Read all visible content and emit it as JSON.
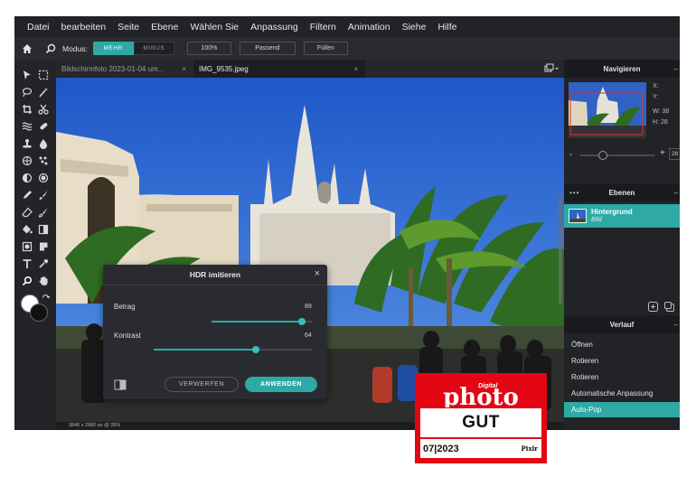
{
  "menu": [
    "Datei",
    "bearbeiten",
    "Seite",
    "Ebene",
    "Wählen Sie",
    "Anpassung",
    "Filtern",
    "Animation",
    "Siehe",
    "Hilfe"
  ],
  "toolbar": {
    "mode_label": "Modus:",
    "mode_active": "MEHR",
    "mode_inactive": "MINUS",
    "zoom": "100%",
    "fit": "Passend",
    "fill": "Füllen"
  },
  "tabs": [
    {
      "label": "Bildschirmfoto 2023-01-04 um...",
      "close": "×"
    },
    {
      "label": "IMG_9535.jpeg",
      "close": "×"
    }
  ],
  "status": "3840 x 2880 px @ 28%",
  "dialog": {
    "title": "HDR imitieren",
    "close": "×",
    "amount_label": "Betrag",
    "amount_value": 89,
    "contrast_label": "Kontrast",
    "contrast_value": 64,
    "discard": "VERWERFEN",
    "apply": "ANWENDEN"
  },
  "navigator": {
    "title": "Navigieren",
    "x_label": "X:",
    "y_label": "Y:",
    "w_label": "W:",
    "w_value": "38",
    "h_label": "H:",
    "h_value": "28",
    "zoom_value": "28",
    "zoom_position": 0.3
  },
  "layers": {
    "title": "Ebenen",
    "name": "Hintergrund",
    "type": "Bild"
  },
  "history": {
    "title": "Verlauf",
    "items": [
      "Öffnen",
      "Rotieren",
      "Rotieren",
      "Automatische Anpassung",
      "Auto-Pop"
    ],
    "active_index": 4
  },
  "badge": {
    "magazine": "photo",
    "magazine_prefix": "Digital",
    "rating": "GUT",
    "issue": "07|2023",
    "brand": "Pixlr"
  },
  "colors": {
    "accent": "#2ea9a5",
    "panel": "#222327",
    "badge_red": "#e30613"
  }
}
